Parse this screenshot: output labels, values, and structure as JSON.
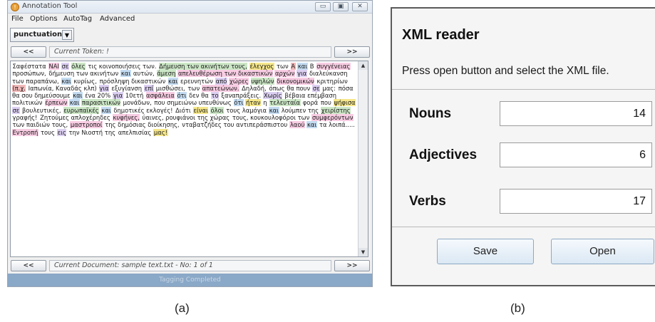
{
  "panel_a": {
    "window_title": "Annotation Tool",
    "win_buttons": [
      "▭",
      "▣",
      "✕"
    ],
    "menu": [
      "File",
      "Options",
      "AutoTag",
      "Advanced"
    ],
    "tag_select": "punctuation",
    "token_nav": {
      "prev": "<<",
      "field": "Current Token: !",
      "next": ">>"
    },
    "text_tokens": [
      {
        "t": "Σαφέστατα",
        "c": ""
      },
      {
        "t": "ΝΑΙ",
        "c": "t-noun"
      },
      {
        "t": "σε",
        "c": "t-prep"
      },
      {
        "t": "όλες",
        "c": "t-adj"
      },
      {
        "t": "τις κοινοποιήσεις των.",
        "c": ""
      },
      {
        "t": "Δήμευση των ακινήτων τους,",
        "c": "t-adj"
      },
      {
        "t": "έλεγχος",
        "c": "t-verb"
      },
      {
        "t": "των",
        "c": ""
      },
      {
        "t": "Α",
        "c": "t-punct"
      },
      {
        "t": "και",
        "c": "t-conj"
      },
      {
        "t": "Β",
        "c": ""
      },
      {
        "t": "συγγένειας",
        "c": "t-noun"
      },
      {
        "t": "προσώπων,",
        "c": ""
      },
      {
        "t": "δήμευση των ακινήτων",
        "c": ""
      },
      {
        "t": "και",
        "c": "t-conj"
      },
      {
        "t": "αυτών,",
        "c": ""
      },
      {
        "t": "άμεση",
        "c": "t-adj"
      },
      {
        "t": "απελευθέρωση των δικαστικών",
        "c": "t-noun"
      },
      {
        "t": "αρχών",
        "c": "t-noun"
      },
      {
        "t": "για",
        "c": "t-prep"
      },
      {
        "t": "διαλεύκανση των παραπάνω,",
        "c": ""
      },
      {
        "t": "και",
        "c": "t-conj"
      },
      {
        "t": "κυρίως,",
        "c": ""
      },
      {
        "t": "πρόσληψη δικαστικών",
        "c": ""
      },
      {
        "t": "και",
        "c": "t-conj"
      },
      {
        "t": "ερευνητών",
        "c": ""
      },
      {
        "t": "από",
        "c": "t-prep"
      },
      {
        "t": "χώρες",
        "c": "t-noun"
      },
      {
        "t": "υψηλών",
        "c": "t-adj"
      },
      {
        "t": "δικονομικών",
        "c": "t-noun"
      },
      {
        "t": "κριτηρίων",
        "c": ""
      },
      {
        "t": "(π.χ.",
        "c": "t-punct"
      },
      {
        "t": "Ιαπωνία, Καναδάς κλπ)",
        "c": ""
      },
      {
        "t": "για",
        "c": "t-prep"
      },
      {
        "t": "εξυγίανση",
        "c": ""
      },
      {
        "t": "επί",
        "c": "t-prep"
      },
      {
        "t": "μισθώσει,",
        "c": ""
      },
      {
        "t": "των",
        "c": ""
      },
      {
        "t": "απατεώνων.",
        "c": "t-noun"
      },
      {
        "t": "Δηλαδή,",
        "c": ""
      },
      {
        "t": "όπως θα πουν",
        "c": ""
      },
      {
        "t": "σε",
        "c": "t-prep"
      },
      {
        "t": "μας:",
        "c": ""
      },
      {
        "t": "πόσα θα σου δημεύσουμε",
        "c": ""
      },
      {
        "t": "και",
        "c": "t-conj"
      },
      {
        "t": "ένα 20%",
        "c": ""
      },
      {
        "t": "για",
        "c": "t-prep"
      },
      {
        "t": "10ετή",
        "c": ""
      },
      {
        "t": "ασφάλεια",
        "c": "t-noun"
      },
      {
        "t": "ότι",
        "c": "t-conj"
      },
      {
        "t": "δεν θα",
        "c": ""
      },
      {
        "t": "το",
        "c": "t-prep"
      },
      {
        "t": "ξαναπράξεις.",
        "c": ""
      },
      {
        "t": "Χωρίς",
        "c": "t-prep"
      },
      {
        "t": "βέβαια επέμβαση πολιτικών",
        "c": ""
      },
      {
        "t": "έρπεων",
        "c": "t-noun"
      },
      {
        "t": "και",
        "c": "t-conj"
      },
      {
        "t": "παρασιτικών",
        "c": "t-adj"
      },
      {
        "t": "μονάδων,",
        "c": ""
      },
      {
        "t": "που σημειώνω υπευθύνως",
        "c": ""
      },
      {
        "t": "ότι",
        "c": "t-conj"
      },
      {
        "t": "ήταν",
        "c": "t-verb"
      },
      {
        "t": "η",
        "c": ""
      },
      {
        "t": "τελευταία",
        "c": "t-adj"
      },
      {
        "t": "φορά",
        "c": ""
      },
      {
        "t": "που",
        "c": ""
      },
      {
        "t": "ψήφισα",
        "c": "t-verb"
      },
      {
        "t": "σε",
        "c": "t-prep"
      },
      {
        "t": "βουλευτικές,",
        "c": ""
      },
      {
        "t": "ευρωπαϊκές",
        "c": "t-adj"
      },
      {
        "t": "και",
        "c": "t-conj"
      },
      {
        "t": "δημοτικές εκλογές!",
        "c": ""
      },
      {
        "t": "Διότι",
        "c": ""
      },
      {
        "t": "είναι",
        "c": "t-verb"
      },
      {
        "t": "όλοι",
        "c": "t-adj"
      },
      {
        "t": "τους λαμόγια",
        "c": ""
      },
      {
        "t": "και",
        "c": "t-conj"
      },
      {
        "t": "λούμπεν της",
        "c": ""
      },
      {
        "t": "χειρίστης",
        "c": "t-adj"
      },
      {
        "t": "γραφής!",
        "c": ""
      },
      {
        "t": "Ζητούμες απλοχέρηδες",
        "c": ""
      },
      {
        "t": "κυφήνες,",
        "c": "t-noun"
      },
      {
        "t": "ύαινες, ρουφιάνοι της χώρας",
        "c": ""
      },
      {
        "t": "τους, κουκουλοφόροι των",
        "c": ""
      },
      {
        "t": "συμφερόντων",
        "c": "t-noun"
      },
      {
        "t": "των παιδιών τους,",
        "c": ""
      },
      {
        "t": "μαστροποί",
        "c": "t-noun"
      },
      {
        "t": "της δημόσιας διοίκησης,",
        "c": ""
      },
      {
        "t": "νταβατζήδες του αντιπεράσπιστου",
        "c": ""
      },
      {
        "t": "λαού",
        "c": "t-noun"
      },
      {
        "t": "και",
        "c": "t-conj"
      },
      {
        "t": "τα λοιπά.....",
        "c": ""
      },
      {
        "t": "Εντροπή",
        "c": "t-noun"
      },
      {
        "t": "τους",
        "c": ""
      },
      {
        "t": "εις",
        "c": "t-prep"
      },
      {
        "t": "την Νιοστή της",
        "c": ""
      },
      {
        "t": "απελπισίας",
        "c": ""
      },
      {
        "t": "μας!",
        "c": "t-verb"
      }
    ],
    "scroll_up": "▲",
    "scroll_down": "▼",
    "doc_nav": {
      "prev": "<<",
      "field": "Current Document: sample text.txt - No: 1 of 1",
      "next": ">>"
    },
    "status": "Tagging Completed",
    "caption": "(a)"
  },
  "panel_b": {
    "title": "XML reader",
    "instruction": "Press open button and select the XML file.",
    "nouns_label": "Nouns",
    "nouns_value": "14",
    "adjectives_label": "Adjectives",
    "adjectives_value": "6",
    "verbs_label": "Verbs",
    "verbs_value": "17",
    "save_label": "Save",
    "open_label": "Open",
    "caption": "(b)"
  }
}
